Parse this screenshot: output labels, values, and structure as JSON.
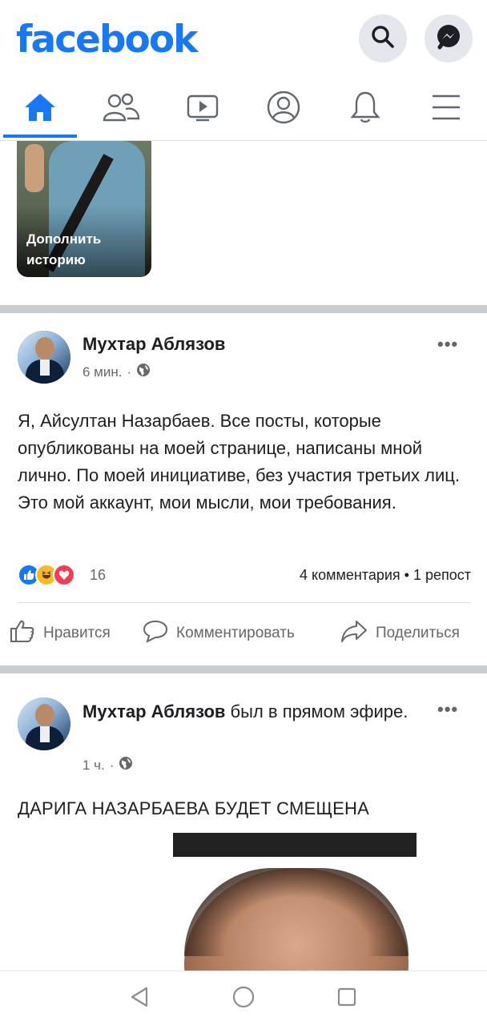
{
  "header": {
    "logo": "facebook"
  },
  "nav": {
    "tabs": [
      {
        "name": "home",
        "icon": "home-icon",
        "active": true
      },
      {
        "name": "friends",
        "icon": "friends-icon"
      },
      {
        "name": "watch",
        "icon": "video-icon"
      },
      {
        "name": "profile",
        "icon": "profile-icon"
      },
      {
        "name": "notifications",
        "icon": "bell-icon"
      },
      {
        "name": "menu",
        "icon": "hamburger-icon"
      }
    ]
  },
  "story": {
    "label": "Дополнить историю"
  },
  "post1": {
    "author": "Мухтар Аблязов",
    "time": "6 мин.",
    "separator": "·",
    "text": "Я, Айсултан Назарбаев. Все посты, которые опубликованы на моей странице,  написаны мной лично. По моей инициативе,  без участия третьих лиц. Это мой аккаунт, мои мысли, мои требования.",
    "reaction_count": "16",
    "counts": "4 комментария • 1 репост",
    "more": "•••"
  },
  "actions": {
    "like": "Нравится",
    "comment": "Комментировать",
    "share": "Поделиться"
  },
  "post2": {
    "author": "Мухтар Аблязов",
    "author_suffix": " был в прямом эфире.",
    "time": "1 ч.",
    "separator": "·",
    "headline": "ДАРИГА НАЗАРБАЕВА БУДЕТ СМЕЩЕНА",
    "more": "•••"
  },
  "colors": {
    "brand": "#1877f2",
    "secondary_text": "#65676b",
    "separator": "#c9ccd1"
  }
}
